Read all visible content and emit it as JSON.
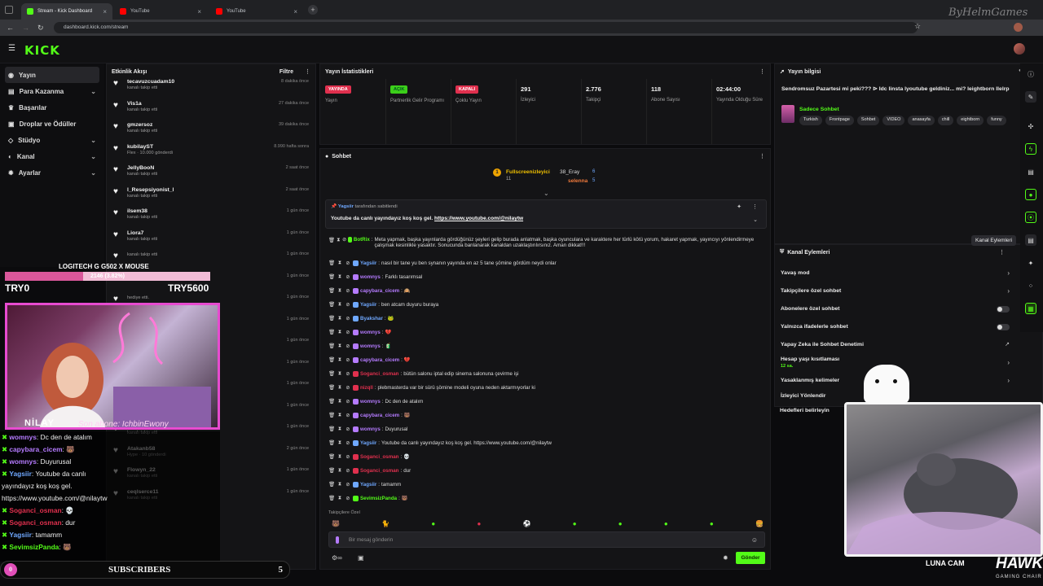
{
  "browser": {
    "tabs": [
      {
        "title": "Stream - Kick Dashboard",
        "color": "#53fc18"
      },
      {
        "title": "YouTube",
        "color": "#ff0000"
      },
      {
        "title": "YouTube",
        "color": "#ff0000"
      }
    ],
    "url": "dashboard.kick.com/stream",
    "watermark": "ByHelmGames"
  },
  "header": {
    "logo": "KICK"
  },
  "nav": {
    "items": [
      {
        "label": "Yayın",
        "icon": "broadcast-icon",
        "active": true,
        "chevron": false
      },
      {
        "label": "Para Kazanma",
        "icon": "wallet-icon",
        "chevron": true
      },
      {
        "label": "Başarılar",
        "icon": "trophy-icon",
        "chevron": false
      },
      {
        "label": "Droplar ve Ödüller",
        "icon": "gift-icon",
        "chevron": false
      },
      {
        "label": "Stüdyo",
        "icon": "studio-icon",
        "chevron": true
      },
      {
        "label": "Kanal",
        "icon": "user-icon",
        "chevron": true
      },
      {
        "label": "Ayarlar",
        "icon": "gear-icon",
        "chevron": true
      }
    ]
  },
  "activity": {
    "title": "Etkinlik Akışı",
    "filter": "Filtre",
    "items": [
      {
        "name": "tecavuzcuadam10",
        "sub": "kanalı takip etti",
        "time": "8 dakika önce"
      },
      {
        "name": "Vis1a",
        "sub": "kanalı takip etti",
        "time": "27 dakika önce"
      },
      {
        "name": "gmzersoz",
        "sub": "kanalı takip etti",
        "time": "39 dakika önce"
      },
      {
        "name": "kubilayST",
        "sub": "Flex · 10.000 gönderdi",
        "time": "8.990 hafta sonra"
      },
      {
        "name": "JellyBooN",
        "sub": "kanalı takip etti",
        "time": "2 saat önce"
      },
      {
        "name": "l_Resepsiyonist_l",
        "sub": "kanalı takip etti",
        "time": "2 saat önce"
      },
      {
        "name": "ilsem38",
        "sub": "kanalı takip etti",
        "time": "1 gün önce"
      },
      {
        "name": "Liora7",
        "sub": "kanalı takip etti",
        "time": "1 gün önce"
      },
      {
        "name": "",
        "sub": "kanalı takip etti",
        "time": "1 gün önce"
      },
      {
        "name": "",
        "sub": "",
        "time": "1 gün önce"
      },
      {
        "name": "",
        "sub": "hediye etti.",
        "time": "1 gün önce"
      },
      {
        "name": "",
        "sub": "hediye etti.",
        "time": "1 gün önce"
      },
      {
        "name": "",
        "sub": "etti.",
        "time": "1 gün önce"
      },
      {
        "name": "",
        "sub": "etti.",
        "time": "1 gün önce"
      },
      {
        "name": "",
        "sub": "etti.",
        "time": "1 gün önce"
      },
      {
        "name": "",
        "sub": "Rage Quit · 500 gönderdi",
        "time": "1 gün önce"
      },
      {
        "name": "sezercancelik",
        "sub": "kanalı takip etti",
        "time": "1 gün önce"
      },
      {
        "name": "Atakanb58",
        "sub": "Hype · 10 gönderdi",
        "time": "2 gün önce"
      },
      {
        "name": "Flowyn_22",
        "sub": "kanalı takip etti",
        "time": "1 gün önce"
      },
      {
        "name": "ceqlserce11",
        "sub": "kanalı takip etti",
        "time": "1 gün önce"
      }
    ]
  },
  "stats": {
    "title": "Yayın İstatistikleri",
    "items": [
      {
        "value": "YAYINDA",
        "label": "Yayın",
        "pill": "#e0304e"
      },
      {
        "value": "AÇIK",
        "label": "Partnerlik Gelir Programı",
        "pill": "#3ccf1a"
      },
      {
        "value": "KAPALI",
        "label": "Çoklu Yayın",
        "pill": "#e0304e"
      },
      {
        "value": "291",
        "label": "İzleyici"
      },
      {
        "value": "2.776",
        "label": "Takipçi"
      },
      {
        "value": "118",
        "label": "Abone Sayısı"
      },
      {
        "value": "02:44:00",
        "label": "Yayında Olduğu Süre"
      }
    ]
  },
  "chat": {
    "title": "Sohbet",
    "top": [
      {
        "name": "Fullscreenizleyici",
        "count": "11"
      },
      {
        "name": "38_Eray",
        "count": "6"
      },
      {
        "name": "selenna",
        "count": "5"
      }
    ],
    "pinned": {
      "by": "Yagsiir",
      "by_suffix": "tarafından sabitlendi",
      "text": "Youtube da canlı yayındayız koş koş gel.",
      "link": "https://www.youtube.com/@nilaytw"
    },
    "messages": [
      {
        "user": "BotRix",
        "color": "#53fc18",
        "text": "Meta yapmak, başka yayınlarda gördüğünüz şeyleri gelip burada anlatmak, başka oyunculara ve karaktere her türlü kötü yorum, hakaret yapmak, yayıncıyı yönlendirmeye çalışmak kesinlikle yasaktır. Sonucunda banlanarak kanaldan uzaklaştırılırsınız. Aman dikkat!!!"
      },
      {
        "user": "Yagsiir",
        "color": "#6fa8ff",
        "text": "nasıl bir tane yu ben synanın yayında en az 5 tane şömine gördüm neydi onlar"
      },
      {
        "user": "womnys",
        "color": "#b57bff",
        "text": "Farklı tasarımsal"
      },
      {
        "user": "capybara_cicem",
        "color": "#b57bff",
        "text": "🙉"
      },
      {
        "user": "Yagsiir",
        "color": "#6fa8ff",
        "text": "ben atcam duyuru buraya"
      },
      {
        "user": "Byakshar",
        "color": "#6fa8ff",
        "text": "🐸"
      },
      {
        "user": "womnys",
        "color": "#b57bff",
        "text": "💔"
      },
      {
        "user": "womnys",
        "color": "#b57bff",
        "text": "🧃"
      },
      {
        "user": "capybara_cicem",
        "color": "#b57bff",
        "text": "💔"
      },
      {
        "user": "Soganci_osman",
        "color": "#e0304e",
        "text": "bütün salonu iptal edip sinema salonuna çevirme işi"
      },
      {
        "user": "nizqll",
        "color": "#e0304e",
        "text": "plebmasterda var bir sürü şömine modeli oyuna neden aktarmıyorlar ki"
      },
      {
        "user": "womnys",
        "color": "#b57bff",
        "text": "Dc den de atalım"
      },
      {
        "user": "capybara_cicem",
        "color": "#b57bff",
        "text": "🐻"
      },
      {
        "user": "womnys",
        "color": "#b57bff",
        "text": "Duyurusal"
      },
      {
        "user": "Yagsiir",
        "color": "#6fa8ff",
        "text": "Youtube da canlı yayındayız koş koş gel. https://www.youtube.com/@nilaytw"
      },
      {
        "user": "Soganci_osman",
        "color": "#e0304e",
        "text": "💀"
      },
      {
        "user": "Soganci_osman",
        "color": "#e0304e",
        "text": "dur"
      },
      {
        "user": "Yagsiir",
        "color": "#6fa8ff",
        "text": "tamamm"
      },
      {
        "user": "SevimsizPanda",
        "color": "#53fc18",
        "text": "🐻"
      }
    ],
    "followers_only": "Takipçilere Özel",
    "input_placeholder": "Bir mesaj gönderin",
    "send": "Gönder"
  },
  "info": {
    "title": "Yayın bilgisi",
    "stream_title": "Sendromsuz Pazartesi mi peki??? ⊳ Idc linsta lyoutube geldiniz... mi? leightborn llelrp",
    "category": "Sadece Sohbet",
    "tags": [
      "Turkish",
      "Frontpage",
      "Sohbet",
      "VIDEO",
      "anasayfa",
      "chill",
      "eightborn",
      "funny"
    ]
  },
  "actions": {
    "title": "Kanal Eylemleri",
    "tooltip": "Kanal Eylemleri",
    "items": [
      {
        "label": "Yavaş mod",
        "ctrl": "chevron"
      },
      {
        "label": "Takipçilere özel sohbet",
        "ctrl": "chevron"
      },
      {
        "label": "Abonelere özel sohbet",
        "ctrl": "toggle"
      },
      {
        "label": "Yalnızca ifadelerle sohbet",
        "ctrl": "toggle"
      },
      {
        "label": "Yapay Zeka ile Sohbet Denetimi",
        "ctrl": "external"
      },
      {
        "label": "Hesap yaşı kısıtlaması",
        "sub": "12 sa.",
        "ctrl": "chevron"
      },
      {
        "label": "Yasaklanmış kelimeler",
        "ctrl": "chevron"
      },
      {
        "label": "İzleyici Yönlendir",
        "ctrl": "none"
      },
      {
        "label": "Hedefleri belirleyin",
        "ctrl": "none"
      }
    ]
  },
  "overlay": {
    "mouse_label": "LOGITECH G G502 X MOUSE",
    "progress_text": "2146 (3.82%)",
    "progress": 0.382,
    "left_price": "TRY0",
    "right_price": "TRY5600",
    "streamer_name": "NİLAY",
    "sub_alert": "Son abone: IchbinEwony",
    "chat": [
      {
        "user": "womnys",
        "color": "#b57bff",
        "text": ": Dc den de atalım"
      },
      {
        "user": "capybara_cicem",
        "color": "#b57bff",
        "text": ": 🐻"
      },
      {
        "user": "womnys",
        "color": "#b57bff",
        "text": ": Duyurusal"
      },
      {
        "user": "Yagsiir",
        "color": "#6fa8ff",
        "text": ": Youtube da canlı"
      },
      {
        "user": "",
        "color": "#eeeeee",
        "text": "yayındayız koş koş gel."
      },
      {
        "user": "",
        "color": "#eeeeee",
        "text": "https://www.youtube.com/@nilaytw"
      },
      {
        "user": "Soganci_osman",
        "color": "#e0304e",
        "text": ": 💀"
      },
      {
        "user": "Soganci_osman",
        "color": "#e0304e",
        "text": ": dur"
      },
      {
        "user": "Yagsiir",
        "color": "#6fa8ff",
        "text": ": tamamm"
      },
      {
        "user": "SevimsizPanda",
        "color": "#53fc18",
        "text": ": 🐻"
      }
    ],
    "subs_label": "SUBSCRIBERS",
    "subs_count": "5",
    "subs_left": "0",
    "cam_label": "LUNA CAM",
    "brand": "HAWK",
    "brand_sub": "GAMING CHAIR"
  },
  "colors": {
    "accent": "#53fc18",
    "live": "#e0304e",
    "webcam_border": "#e74bd0"
  }
}
